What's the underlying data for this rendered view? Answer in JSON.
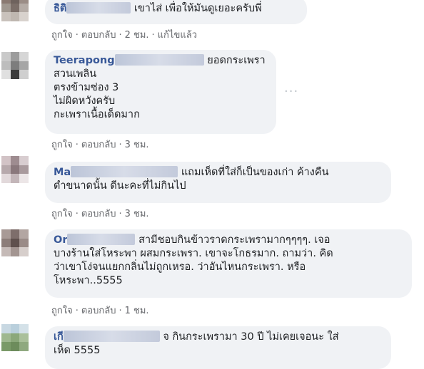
{
  "comments": [
    {
      "name_visible": "ธิติ",
      "text_lines": [
        "เขาไส่ เพื่อให้มันดูเยอะครับพี่"
      ],
      "actions": {
        "like": "ถูกใจ",
        "reply": "ตอบกลับ",
        "time": "2 ชม.",
        "edited": "แก้ไขแล้ว"
      }
    },
    {
      "name_visible": "Teerapong",
      "text_first": "ยอดกระเพรา",
      "text_lines": [
        "สวนเพลิน",
        "ตรงข้ามซ่อง 3",
        "ไม่ผิดหวังครับ",
        "กะเพราเนื้อเด็ดมาก"
      ],
      "actions": {
        "like": "ถูกใจ",
        "reply": "ตอบกลับ",
        "time": "3 ชม."
      }
    },
    {
      "name_visible": "Ma",
      "text_first": "แถมเห็ดที่ใส่ก็เป็นของเก่า ค้างคืน",
      "text_lines": [
        "ดำขนาดนั้น ดีนะคะที่ไม่กินไป"
      ],
      "actions": {
        "like": "ถูกใจ",
        "reply": "ตอบกลับ",
        "time": "3 ชม."
      }
    },
    {
      "name_visible": "Or",
      "text_first": "สามีชอบกินข้าวราดกระเพรามากๆๆๆๆ. เจอ",
      "text_lines": [
        "บางร้านใส่โหระพา ผสมกระเพรา. เขาจะโกธรมาก. ถามว่า. คิด",
        "ว่าเขาโง่จนแยกกลิ่นไม่ถูกเหรอ. ว่าอันไหนกระเพรา. หรือ",
        "โหระพา..5555"
      ],
      "actions": {
        "like": "ถูกใจ",
        "reply": "ตอบกลับ",
        "time": "1 ชม."
      }
    },
    {
      "name_visible": "เกี",
      "text_first": "จ กินกระเพรามา 30 ปี ไม่เคยเจอนะ ใส่",
      "text_lines": [
        "เห็ด 5555"
      ]
    }
  ],
  "icons": {
    "more": "more-options-icon"
  }
}
